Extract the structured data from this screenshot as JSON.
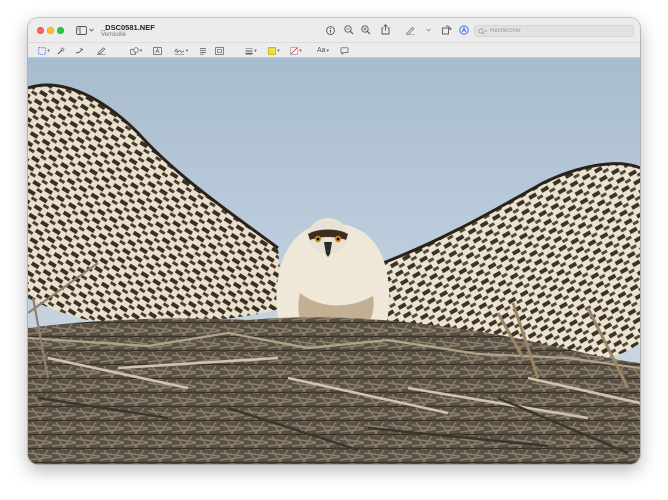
{
  "window": {
    "document_name": "_DSC0581.NEF",
    "status": "Verrouillé"
  },
  "toolbar": {
    "icons": [
      "sidebar-icon",
      "chevron-down-icon",
      "info-icon",
      "zoom-out-icon",
      "zoom-in-icon",
      "share-icon",
      "markup-pen-icon",
      "chevron-down-icon",
      "rotate-icon",
      "highlight-circle-icon"
    ],
    "search_placeholder": "Rechercher"
  },
  "markup_toolbar": {
    "tools": [
      "selection-icon",
      "instant-alpha-icon",
      "sketch-icon",
      "draw-icon",
      "shapes-icon",
      "text-box-icon",
      "sign-icon",
      "notes-icon",
      "crop-icon",
      "line-style-icon",
      "border-color-icon",
      "fill-color-icon",
      "text-style-icon",
      "description-icon"
    ],
    "text_style_label": "Aa"
  },
  "image": {
    "subject": "photo-osprey-nest"
  },
  "colors": {
    "accent": "#2d6cdf",
    "sky": "#b4c6d8",
    "close": "#ff5f57",
    "minimize": "#febc2e",
    "zoom": "#28c840",
    "fill_swatch": "#e6e04a"
  }
}
